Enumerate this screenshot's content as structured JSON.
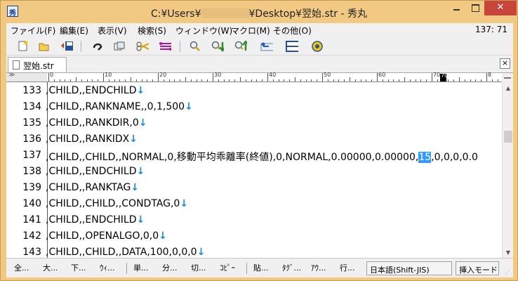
{
  "window": {
    "title_prefix": "C:¥Users¥",
    "title_suffix": "¥Desktop¥翌始.str  - 秀丸",
    "close_glyph": "✕",
    "accent_color": "#f2c982",
    "close_color": "#c7453b"
  },
  "menu": {
    "items": [
      "ファイル(F)",
      "編集(E)",
      "表示(V)",
      "検索(S)",
      "ウィンドウ(W)",
      "マクロ(M)",
      "その他(O)"
    ],
    "cursor_position": "137: 71"
  },
  "toolbar": {
    "icons": [
      "new-file-icon",
      "open-folder-icon",
      "save-icon",
      "undo-icon",
      "copy-icon",
      "cut-icon",
      "paste-icon",
      "find-icon",
      "find-down-icon",
      "find-up-icon",
      "grep-icon",
      "window-split-icon",
      "help-icon"
    ]
  },
  "tab": {
    "file_name": "翌始.str",
    "close_glyph": "×"
  },
  "ruler": {
    "gutter_label": "≫",
    "marks": [
      "0",
      "10",
      "20",
      "30",
      "40",
      "50",
      "60",
      "70",
      "8"
    ],
    "caret_label": "70"
  },
  "editor": {
    "lines": [
      {
        "num": "133",
        "text": ",CHILD,,ENDCHILD",
        "eol": "↓"
      },
      {
        "num": "134",
        "text": ",CHILD,,RANKNAME,,0,1,500",
        "eol": "↓"
      },
      {
        "num": "135",
        "text": ",CHILD,,RANKDIR,0",
        "eol": "↓"
      },
      {
        "num": "136",
        "text": ",CHILD,,RANKIDX",
        "eol": "↓"
      },
      {
        "num": "137",
        "text": ",CHILD,,CHILD,,NORMAL,0,移動平均乖離率(終値),0,NORMAL,0.00000,0.00000,",
        "selected": "15",
        "after": ",0,0,0,0.0",
        "eol": ""
      },
      {
        "num": "138",
        "text": ",CHILD,,ENDCHILD",
        "eol": "↓"
      },
      {
        "num": "139",
        "text": ",CHILD,,RANKTAG",
        "eol": "↓"
      },
      {
        "num": "140",
        "text": ",CHILD,,CHILD,,CONDTAG,0",
        "eol": "↓"
      },
      {
        "num": "141",
        "text": ",CHILD,,ENDCHILD",
        "eol": "↓"
      },
      {
        "num": "142",
        "text": ",CHILD,,OPENALGO,0,0",
        "eol": "↓"
      },
      {
        "num": "143",
        "text": ",CHILD,,CHILD,,DATA,100,0,0,0",
        "eol": "↓"
      }
    ]
  },
  "fkeys": [
    "全...",
    "大...",
    "下...",
    "ｳｨ...",
    "単...",
    "分...",
    "切...",
    "ｺﾋﾟｰ",
    "貼...",
    "ﾀｸﾞ...",
    "ｱｳ...",
    "行..."
  ],
  "status": {
    "encoding": "日本語(Shift-JIS)",
    "mode": "挿入モード"
  }
}
